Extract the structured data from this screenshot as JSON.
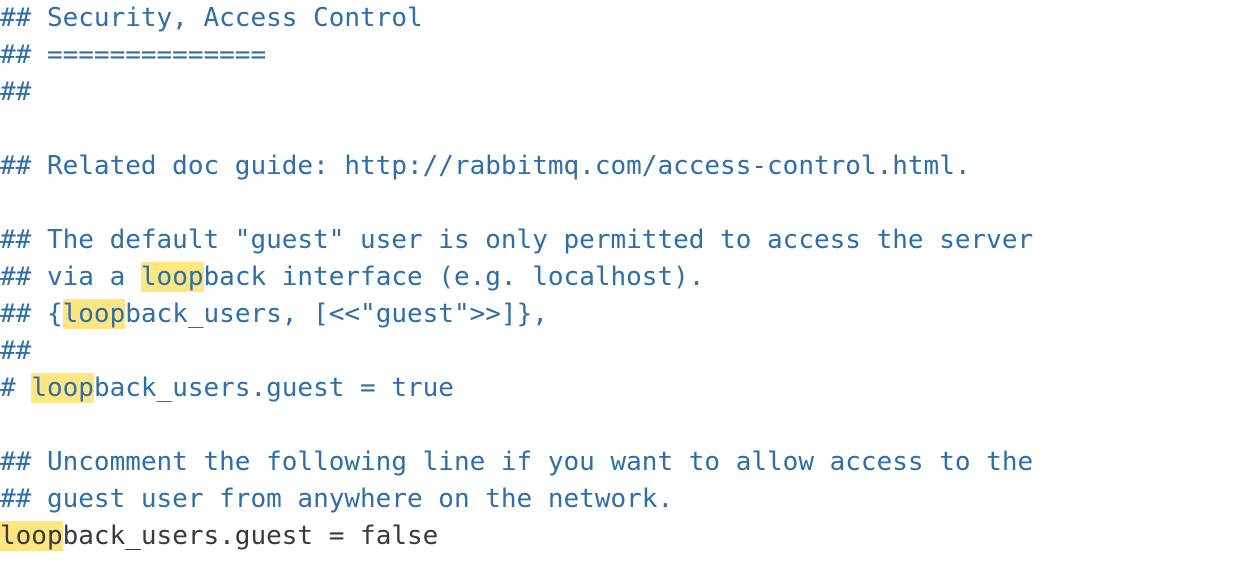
{
  "highlight_token": "loop",
  "lines": {
    "l1": {
      "c1": "## Security, Access Control"
    },
    "l2": {
      "c1": "## =============="
    },
    "l3": {
      "c1": "##"
    },
    "l4": {
      "blank": ""
    },
    "l5": {
      "c1": "## Related doc guide: http://rabbitmq.com/access-control.html."
    },
    "l6": {
      "blank": ""
    },
    "l7": {
      "c1": "## The default \"guest\" user is only permitted to access the server"
    },
    "l8": {
      "c1": "## via a ",
      "hl": "loop",
      "c2": "back interface (e.g. localhost)."
    },
    "l9": {
      "c1": "## {",
      "hl": "loop",
      "c2": "back_users, [<<\"guest\">>]},"
    },
    "l10": {
      "c1": "##"
    },
    "l11": {
      "c1": "# ",
      "hl": "loop",
      "c2": "back_users.guest = true"
    },
    "l12": {
      "blank": ""
    },
    "l13": {
      "c1": "## Uncomment the following line if you want to allow access to the"
    },
    "l14": {
      "c1": "## guest user from anywhere on the network."
    },
    "l15": {
      "hl": "loop",
      "p1": "back_users.guest = false"
    }
  }
}
